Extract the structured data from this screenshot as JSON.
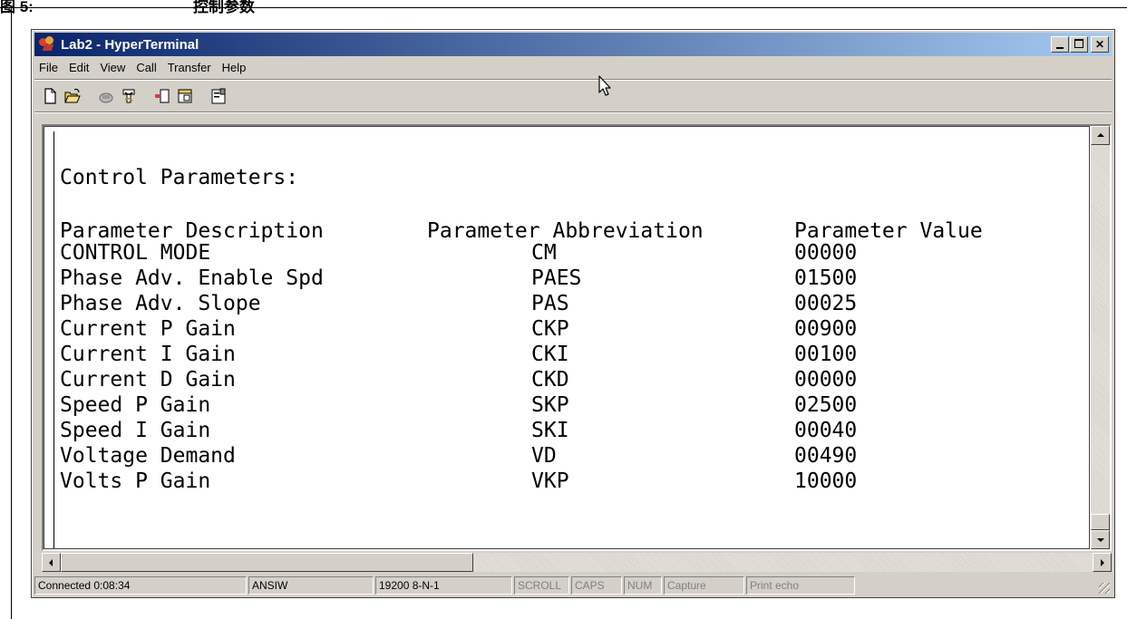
{
  "caption": {
    "fig": "图 5:",
    "text": "控制参数"
  },
  "window": {
    "title": "Lab2 - HyperTerminal"
  },
  "menu": [
    "File",
    "Edit",
    "View",
    "Call",
    "Transfer",
    "Help"
  ],
  "toolbar": {
    "icons": [
      "new-file-icon",
      "open-folder-icon",
      "phone-connect-icon",
      "phone-disconnect-icon",
      "send-file-icon",
      "receive-file-icon",
      "properties-icon"
    ]
  },
  "terminal": {
    "title": "Control Parameters:",
    "headers": [
      "Parameter Description",
      "Parameter Abbreviation",
      "Parameter Value"
    ],
    "rows": [
      {
        "desc": "CONTROL MODE",
        "abbr": "CM",
        "value": "00000"
      },
      {
        "desc": "Phase Adv. Enable Spd",
        "abbr": "PAES",
        "value": "01500"
      },
      {
        "desc": "Phase Adv. Slope",
        "abbr": "PAS",
        "value": "00025"
      },
      {
        "desc": "Current P Gain",
        "abbr": "CKP",
        "value": "00900"
      },
      {
        "desc": "Current I Gain",
        "abbr": "CKI",
        "value": "00100"
      },
      {
        "desc": "Current D Gain",
        "abbr": "CKD",
        "value": "00000"
      },
      {
        "desc": "Speed P Gain",
        "abbr": "SKP",
        "value": "02500"
      },
      {
        "desc": "Speed I Gain",
        "abbr": "SKI",
        "value": "00040"
      },
      {
        "desc": "Voltage Demand",
        "abbr": "VD",
        "value": "00490"
      },
      {
        "desc": "Volts P Gain",
        "abbr": "VKP",
        "value": "10000"
      }
    ]
  },
  "status": {
    "connected": "Connected 0:08:34",
    "emulation": "ANSIW",
    "port": "19200 8-N-1",
    "scroll": "SCROLL",
    "caps": "CAPS",
    "num": "NUM",
    "capture": "Capture",
    "print_echo": "Print echo"
  }
}
